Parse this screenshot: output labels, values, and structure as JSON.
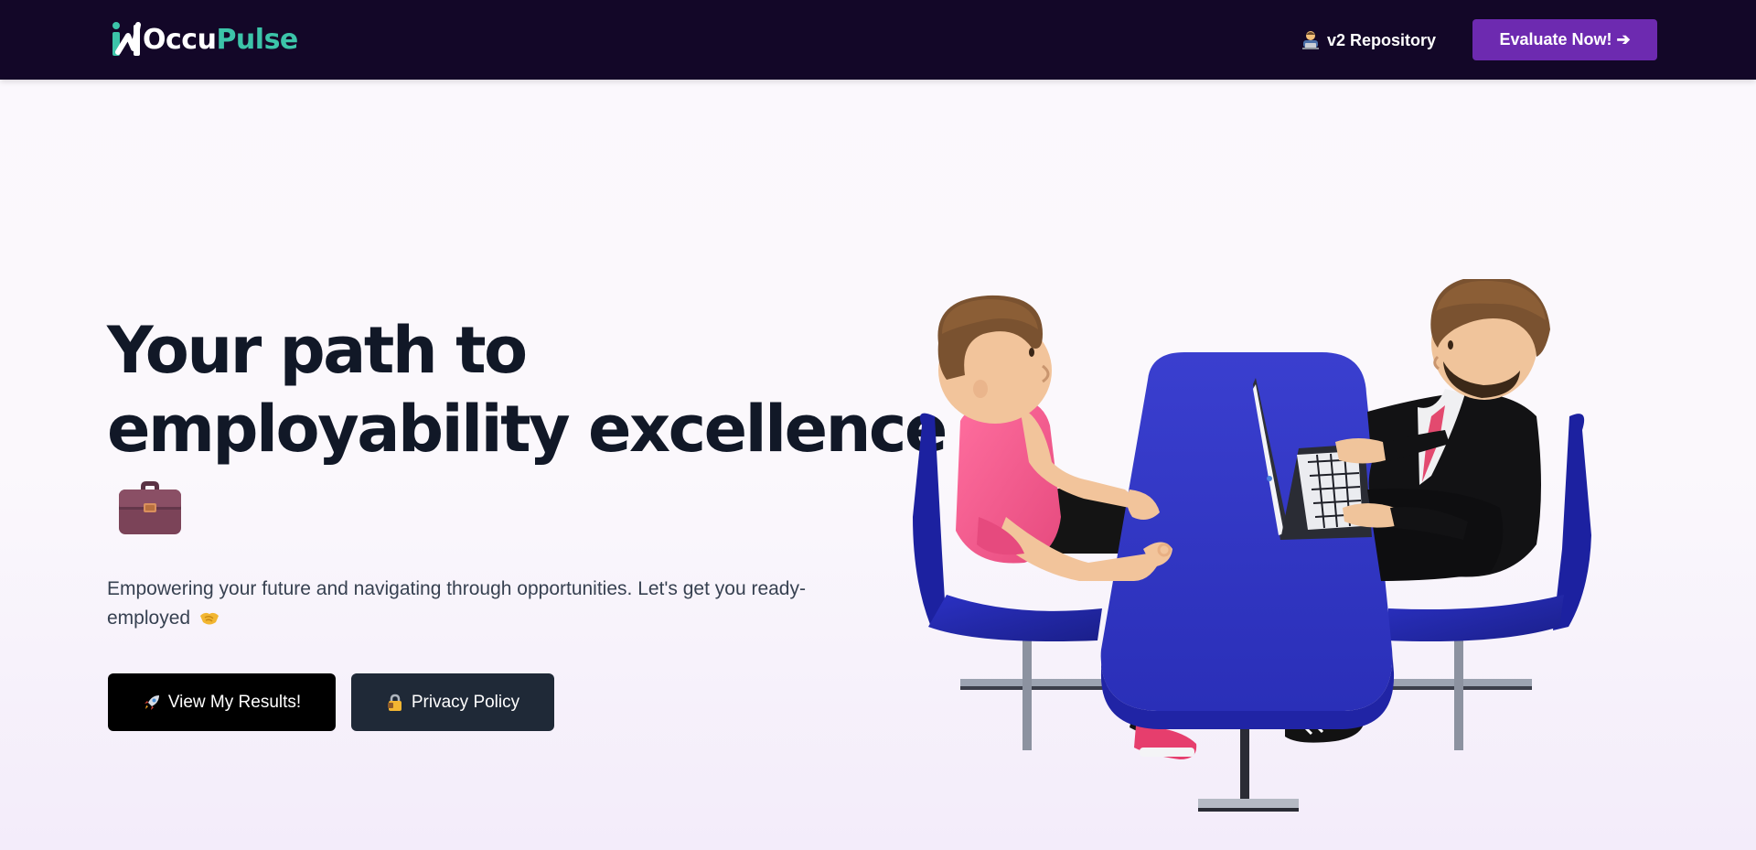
{
  "navbar": {
    "logo": {
      "part1": "Occu",
      "part2": "Pulse",
      "icon": "occupulse-logo-icon"
    },
    "repo_link": {
      "icon": "technologist-emoji-icon",
      "label": "v2 Repository"
    },
    "cta_button": {
      "label": "Evaluate Now! ➔"
    }
  },
  "hero": {
    "title_line1": "Your path to",
    "title_line2": "employability excellence",
    "title_icon": "briefcase-emoji-icon",
    "subtitle_line1": "Empowering your future and navigating through opportunities. Let's get you ready-",
    "subtitle_line2": "employed",
    "subtitle_icon": "handshake-emoji-icon",
    "buttons": {
      "results": {
        "icon": "rocket-emoji-icon",
        "label": "View My Results!"
      },
      "privacy": {
        "icon": "lock-emoji-icon",
        "label": "Privacy Policy"
      }
    },
    "illustration": "interview-meeting-illustration"
  },
  "colors": {
    "navbar_bg": "#130728",
    "brand_teal": "#3cc4a9",
    "cta_purple": "#6d2ab0",
    "heading": "#111827",
    "button_dark": "#1f2937"
  }
}
